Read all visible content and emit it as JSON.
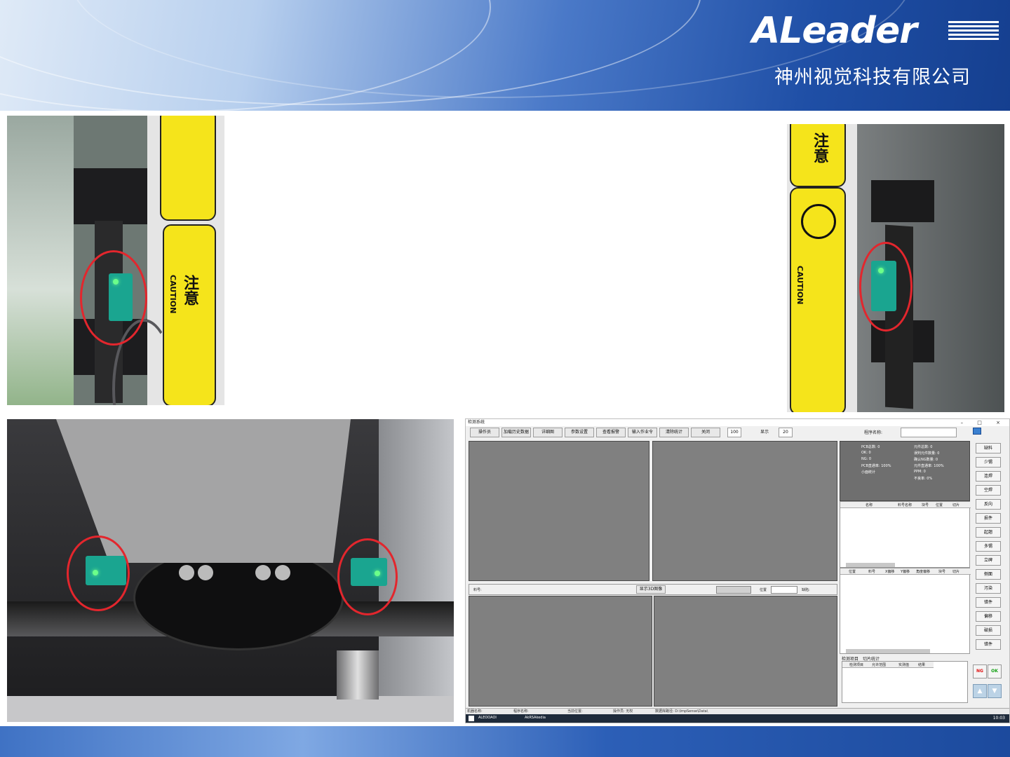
{
  "brand": {
    "logo_text": "ALeader",
    "company_name": "神州视觉科技有限公司"
  },
  "photos": {
    "top_left": {
      "caution_lines": [
        "注",
        "意"
      ],
      "caution_en": "CAUTION"
    },
    "top_right": {
      "caution_lines": [
        "注",
        "意"
      ],
      "caution_en": "CAUTION"
    }
  },
  "software": {
    "window_title": "检测系统",
    "window_controls": "– □ ×",
    "toolbar": [
      "操作员",
      "加载历史数据",
      "详细图",
      "参数设置",
      "查看报警",
      "输入作业令",
      "清除统计",
      "关闭"
    ],
    "zoom_value": "100",
    "display_label": "显示",
    "display_value": "20",
    "program_label": "程序名称:",
    "stats_left": [
      "PCB总数: 0",
      "OK: 0",
      "NG: 0",
      "PCB直通率: 100%",
      "小面统计"
    ],
    "stats_right": [
      "元件总数: 0",
      "误判元件数量: 0",
      "确认NG数量: 0",
      "元件直通率: 100%",
      "PPM: 0",
      "不良率: 0%"
    ],
    "table1_headers": [
      "名称",
      "料号名称",
      "块号",
      "位置",
      "切片"
    ],
    "table2_headers": [
      "位置",
      "料号",
      "X偏移",
      "Y偏移",
      "角度偏移",
      "块号",
      "切片"
    ],
    "lower_bar": {
      "part_label": "料号:",
      "show_3d": "显示3D图像",
      "position_label": "位置",
      "defect_label": "缺陷:"
    },
    "tabs": [
      "检测项目",
      "切片统计"
    ],
    "table3_headers": [
      "检测项目",
      "允许范围",
      "实测值",
      "结果"
    ],
    "right_buttons": [
      "缺料",
      "少锡",
      "连焊",
      "空焊",
      "反向",
      "损件",
      "起翘",
      "多锡",
      "立碑",
      "侧面",
      "污染",
      "错件",
      "偏移",
      "破损",
      "错件"
    ],
    "ng_label": "NG",
    "ok_label": "OK",
    "status_items": [
      "机器名称:",
      "程序名称:",
      "当前位置:",
      "操作员: 无权",
      "数据库路径: D:\\ImpSense\\Data\\"
    ],
    "taskbar_items": [
      "ALEOOAOI",
      "AkRSAkedia"
    ],
    "tray_text": "10:03"
  }
}
